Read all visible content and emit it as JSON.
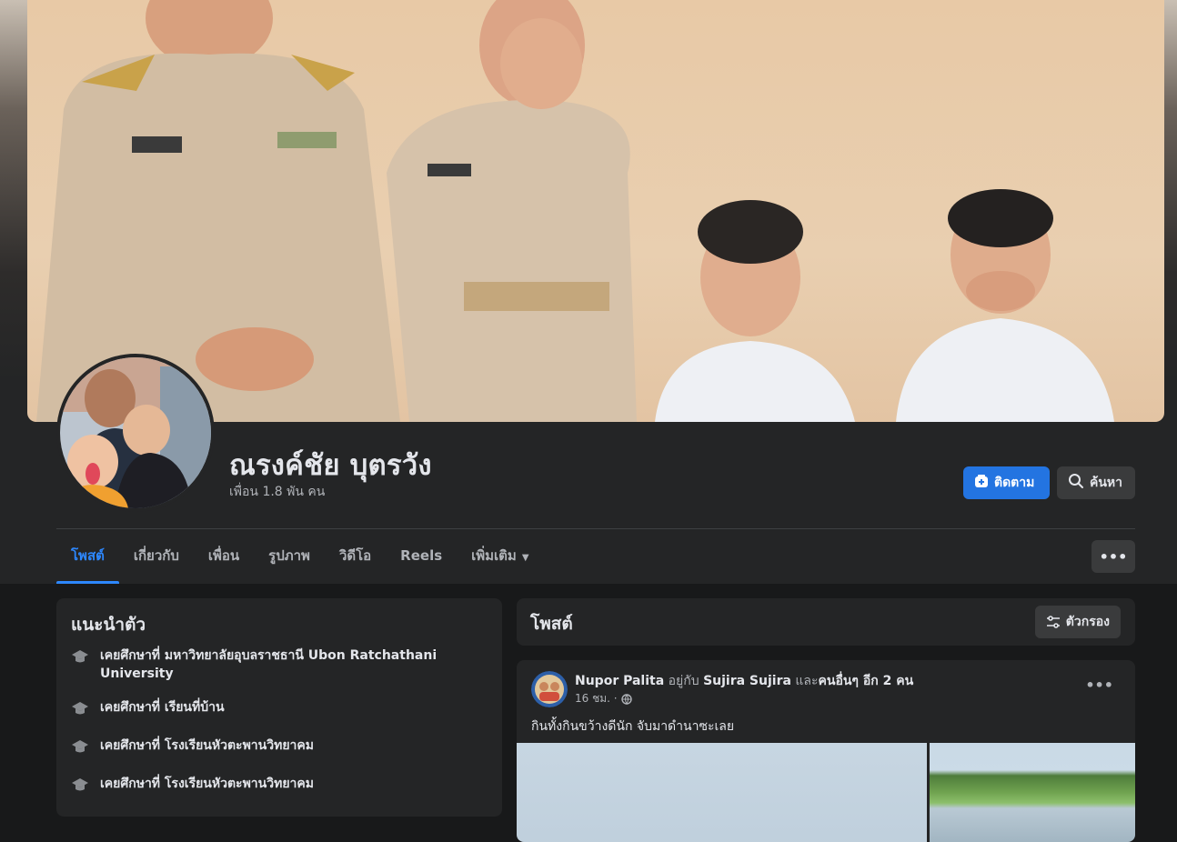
{
  "profile": {
    "name": "ณรงค์ชัย บุตรวัง",
    "friends": "เพื่อน 1.8 พัน คน"
  },
  "actions": {
    "follow_label": "ติดตาม",
    "search_label": "ค้นหา",
    "more_label": "•••"
  },
  "tabs": [
    {
      "label": "โพสต์",
      "active": true
    },
    {
      "label": "เกี่ยวกับ"
    },
    {
      "label": "เพื่อน"
    },
    {
      "label": "รูปภาพ"
    },
    {
      "label": "วิดีโอ"
    },
    {
      "label": "Reels"
    },
    {
      "label": "เพิ่มเติม",
      "caret": "▼"
    }
  ],
  "intro": {
    "title": "แนะนำตัว",
    "items": [
      {
        "text": "เคยศึกษาที่ มหาวิทยาลัยอุบลราชธานี Ubon Ratchathani University",
        "icon": "graduation-cap-icon"
      },
      {
        "text": "เคยศึกษาที่ เรียนที่บ้าน",
        "icon": "graduation-cap-icon"
      },
      {
        "text": "เคยศึกษาที่ โรงเรียนหัวตะพานวิทยาคม",
        "icon": "graduation-cap-icon"
      },
      {
        "text": "เคยศึกษาที่ โรงเรียนหัวตะพานวิทยาคม",
        "icon": "graduation-cap-icon"
      }
    ]
  },
  "posts_section": {
    "title": "โพสต์",
    "filter_label": "ตัวกรอง"
  },
  "post": {
    "author": "Nupor Palita",
    "with_word": "อยู่กับ",
    "tagged": "Sujira Sujira",
    "and_word": "และ",
    "others": "คนอื่นๆ อีก 2 คน",
    "time": "16 ชม. ·",
    "text": "กินทั้งกินขว้างดีนัก จับมาดำนาซะเลย",
    "menu_label": "•••"
  },
  "colors": {
    "background": "#18191a",
    "surface": "#242526",
    "accent": "#2374e1",
    "active_tab": "#2d88ff"
  }
}
